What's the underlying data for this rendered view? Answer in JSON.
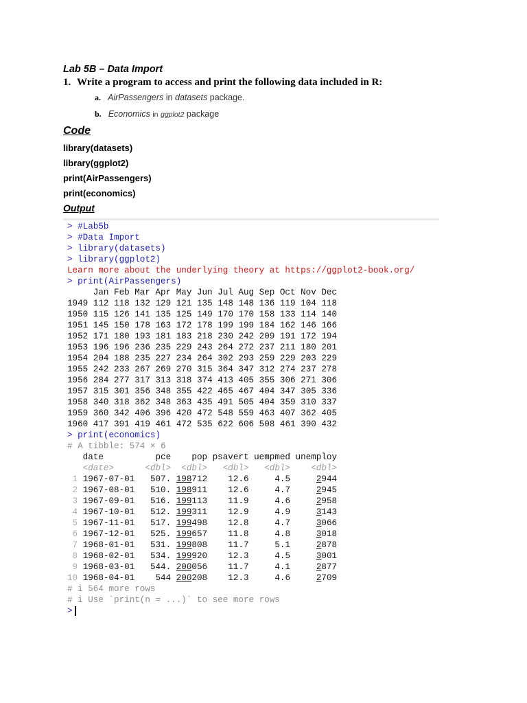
{
  "document": {
    "title": "Lab 5B – Data Import",
    "question_number": "1.",
    "question": "Write a program to access and print the following data included in R:",
    "items": [
      {
        "marker": "a.",
        "dataset": "AirPassengers",
        "in": "in",
        "package": "datasets",
        "suffix": "package."
      },
      {
        "marker": "b.",
        "dataset": "Economics",
        "in": "in",
        "package": "ggplot2",
        "suffix": "package"
      }
    ],
    "code_heading": "Code",
    "code_lines": [
      "library(datasets)",
      "library(ggplot2)",
      "print(AirPassengers)",
      "print(economics)"
    ],
    "output_heading": "Output"
  },
  "console": {
    "prompt": ">",
    "commands_top": [
      "#Lab5b",
      "#Data Import",
      "library(datasets)",
      "library(ggplot2)"
    ],
    "message": "Learn more about the underlying theory at https://ggplot2-book.org/",
    "cmd_air": "print(AirPassengers)",
    "air": {
      "months": [
        "Jan",
        "Feb",
        "Mar",
        "Apr",
        "May",
        "Jun",
        "Jul",
        "Aug",
        "Sep",
        "Oct",
        "Nov",
        "Dec"
      ],
      "rows": [
        {
          "year": "1949",
          "values": [
            112,
            118,
            132,
            129,
            121,
            135,
            148,
            148,
            136,
            119,
            104,
            118
          ]
        },
        {
          "year": "1950",
          "values": [
            115,
            126,
            141,
            135,
            125,
            149,
            170,
            170,
            158,
            133,
            114,
            140
          ]
        },
        {
          "year": "1951",
          "values": [
            145,
            150,
            178,
            163,
            172,
            178,
            199,
            199,
            184,
            162,
            146,
            166
          ]
        },
        {
          "year": "1952",
          "values": [
            171,
            180,
            193,
            181,
            183,
            218,
            230,
            242,
            209,
            191,
            172,
            194
          ]
        },
        {
          "year": "1953",
          "values": [
            196,
            196,
            236,
            235,
            229,
            243,
            264,
            272,
            237,
            211,
            180,
            201
          ]
        },
        {
          "year": "1954",
          "values": [
            204,
            188,
            235,
            227,
            234,
            264,
            302,
            293,
            259,
            229,
            203,
            229
          ]
        },
        {
          "year": "1955",
          "values": [
            242,
            233,
            267,
            269,
            270,
            315,
            364,
            347,
            312,
            274,
            237,
            278
          ]
        },
        {
          "year": "1956",
          "values": [
            284,
            277,
            317,
            313,
            318,
            374,
            413,
            405,
            355,
            306,
            271,
            306
          ]
        },
        {
          "year": "1957",
          "values": [
            315,
            301,
            356,
            348,
            355,
            422,
            465,
            467,
            404,
            347,
            305,
            336
          ]
        },
        {
          "year": "1958",
          "values": [
            340,
            318,
            362,
            348,
            363,
            435,
            491,
            505,
            404,
            359,
            310,
            337
          ]
        },
        {
          "year": "1959",
          "values": [
            360,
            342,
            406,
            396,
            420,
            472,
            548,
            559,
            463,
            407,
            362,
            405
          ]
        },
        {
          "year": "1960",
          "values": [
            417,
            391,
            419,
            461,
            472,
            535,
            622,
            606,
            508,
            461,
            390,
            432
          ]
        }
      ]
    },
    "cmd_econ": "print(economics)",
    "tibble_info": "# A tibble: 574 × 6",
    "econ": {
      "columns": [
        "date",
        "pce",
        "pop",
        "psavert",
        "uempmed",
        "unemploy"
      ],
      "types": [
        "<date>",
        "<dbl>",
        "<dbl>",
        "<dbl>",
        "<dbl>",
        "<dbl>"
      ],
      "rows": [
        [
          "1",
          "1967-07-01",
          "507.",
          "198712",
          "12.6",
          "4.5",
          "2944"
        ],
        [
          "2",
          "1967-08-01",
          "510.",
          "198911",
          "12.6",
          "4.7",
          "2945"
        ],
        [
          "3",
          "1967-09-01",
          "516.",
          "199113",
          "11.9",
          "4.6",
          "2958"
        ],
        [
          "4",
          "1967-10-01",
          "512.",
          "199311",
          "12.9",
          "4.9",
          "3143"
        ],
        [
          "5",
          "1967-11-01",
          "517.",
          "199498",
          "12.8",
          "4.7",
          "3066"
        ],
        [
          "6",
          "1967-12-01",
          "525.",
          "199657",
          "11.8",
          "4.8",
          "3018"
        ],
        [
          "7",
          "1968-01-01",
          "531.",
          "199808",
          "11.7",
          "5.1",
          "2878"
        ],
        [
          "8",
          "1968-02-01",
          "534.",
          "199920",
          "12.3",
          "4.5",
          "3001"
        ],
        [
          "9",
          "1968-03-01",
          "544.",
          "200056",
          "11.7",
          "4.1",
          "2877"
        ],
        [
          "10",
          "1968-04-01",
          "544",
          "200208",
          "12.3",
          "4.6",
          "2709"
        ]
      ]
    },
    "footer": [
      "# i 564 more rows",
      "# i Use `print(n = ...)` to see more rows"
    ]
  }
}
